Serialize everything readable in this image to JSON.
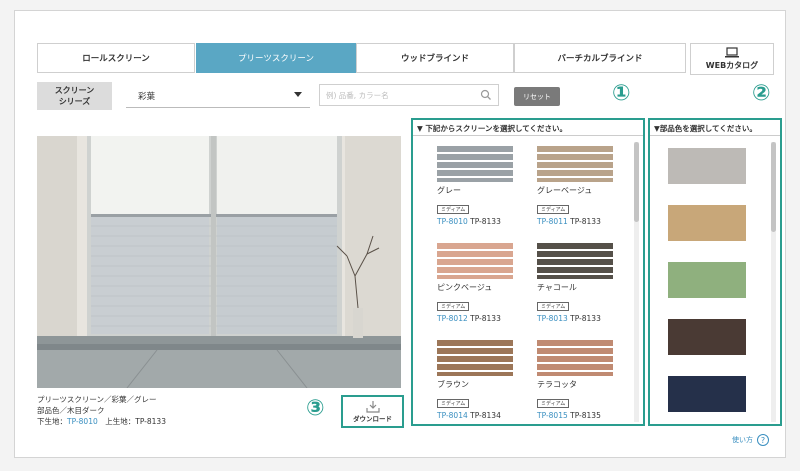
{
  "tabs": [
    {
      "label": "ロールスクリーン",
      "active": false
    },
    {
      "label": "プリーツスクリーン",
      "active": true
    },
    {
      "label": "ウッドブラインド",
      "active": false
    },
    {
      "label": "バーチカルブラインド",
      "active": false
    }
  ],
  "catalog": {
    "label": "WEBカタログ"
  },
  "series": {
    "label_line1": "スクリーン",
    "label_line2": "シリーズ",
    "selected": "彩葉"
  },
  "search": {
    "placeholder": "例) 品番, カラー名"
  },
  "reset_label": "リセット",
  "markers": {
    "one": "①",
    "two": "②",
    "three": "③"
  },
  "caption": {
    "line1": "プリーツスクリーン／彩葉／グレー",
    "line2": "部品色／木目ダーク",
    "line3_prefix": "下生地：",
    "line3_link": "TP-8010",
    "line3_suffix": "　上生地：TP-8133"
  },
  "download_label": "ダウンロード",
  "screen_panel": {
    "heading": "▼ 下記からスクリーンを選択してください。",
    "items": [
      {
        "name": "グレー",
        "badge": "ミディアム",
        "code1": "TP-8010",
        "code2": "TP-8133",
        "color": "#9aa1a6"
      },
      {
        "name": "グレーベージュ",
        "badge": "ミディアム",
        "code1": "TP-8011",
        "code2": "TP-8133",
        "color": "#b9a38a"
      },
      {
        "name": "ピンクベージュ",
        "badge": "ミディアム",
        "code1": "TP-8012",
        "code2": "TP-8133",
        "color": "#d9a690"
      },
      {
        "name": "チャコール",
        "badge": "ミディアム",
        "code1": "TP-8013",
        "code2": "TP-8133",
        "color": "#555049"
      },
      {
        "name": "ブラウン",
        "badge": "ミディアム",
        "code1": "TP-8014",
        "code2": "TP-8134",
        "color": "#9c7658"
      },
      {
        "name": "テラコッタ",
        "badge": "ミディアム",
        "code1": "TP-8015",
        "code2": "TP-8135",
        "color": "#c08a72"
      }
    ]
  },
  "color_panel": {
    "heading": "▼部品色を選択してください。",
    "colors": [
      "#bdbab6",
      "#c8a779",
      "#8fb07e",
      "#4a3a34",
      "#25304a"
    ]
  },
  "help_label": "使い方",
  "help_icon": "?"
}
